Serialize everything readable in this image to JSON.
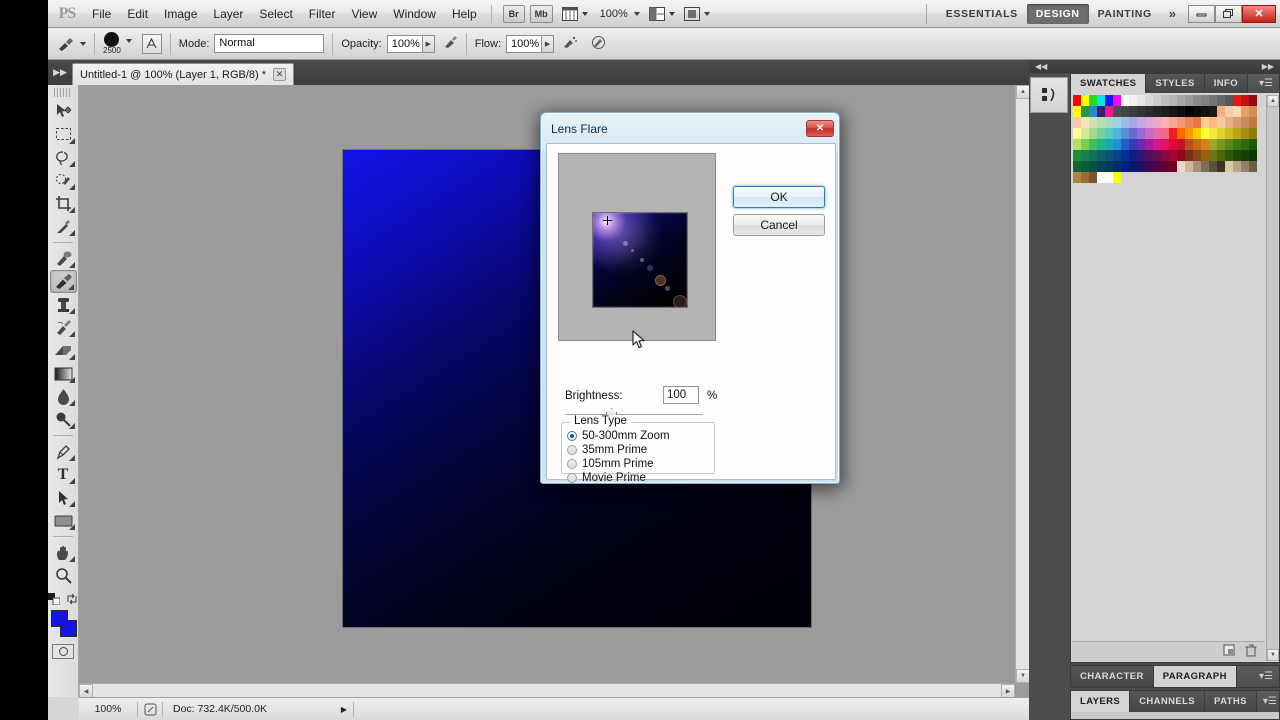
{
  "app": {
    "name": "Adobe Photoshop",
    "logo_text": "PS"
  },
  "menubar": {
    "items": [
      "File",
      "Edit",
      "Image",
      "Layer",
      "Select",
      "Filter",
      "View",
      "Window",
      "Help"
    ],
    "bridge_button": "Br",
    "minibridge_button": "Mb",
    "zoom_level": "100%",
    "workspaces": [
      "ESSENTIALS",
      "DESIGN",
      "PAINTING"
    ],
    "active_workspace": "DESIGN",
    "overflow_chevron": "»",
    "window_buttons": {
      "minimize": "━",
      "restore": "❐",
      "close": "✕"
    }
  },
  "options_bar": {
    "brush_size": "2500",
    "mode_label": "Mode:",
    "mode_value": "Normal",
    "opacity_label": "Opacity:",
    "opacity_value": "100%",
    "flow_label": "Flow:",
    "flow_value": "100%"
  },
  "document": {
    "tab_title": "Untitled-1 @ 100% (Layer 1, RGB/8) *",
    "close_glyph": "✕"
  },
  "toolbar": {
    "tools": [
      {
        "name": "move-tool",
        "glyph": "➤"
      },
      {
        "name": "rectangular-marquee-tool",
        "glyph": "⬚"
      },
      {
        "name": "lasso-tool",
        "glyph": "⬭"
      },
      {
        "name": "quick-selection-tool",
        "glyph": "✎"
      },
      {
        "name": "crop-tool",
        "glyph": "⌗"
      },
      {
        "name": "eyedropper-tool",
        "glyph": "✒"
      },
      {
        "name": "spot-healing-brush-tool",
        "glyph": "⌘"
      },
      {
        "name": "brush-tool",
        "glyph": "✏"
      },
      {
        "name": "clone-stamp-tool",
        "glyph": "⚑"
      },
      {
        "name": "history-brush-tool",
        "glyph": "✍"
      },
      {
        "name": "eraser-tool",
        "glyph": "▰"
      },
      {
        "name": "gradient-tool",
        "glyph": "■"
      },
      {
        "name": "blur-tool",
        "glyph": "●"
      },
      {
        "name": "dodge-tool",
        "glyph": "◐"
      },
      {
        "name": "pen-tool",
        "glyph": "✑"
      },
      {
        "name": "type-tool",
        "glyph": "T"
      },
      {
        "name": "path-selection-tool",
        "glyph": "➤"
      },
      {
        "name": "rectangle-tool",
        "glyph": "▭"
      },
      {
        "name": "hand-tool",
        "glyph": "✋"
      },
      {
        "name": "zoom-tool",
        "glyph": "⚲"
      }
    ],
    "selected_tool": "brush-tool",
    "foreground_color": "#1414e8",
    "background_color": "#1414e8"
  },
  "status_bar": {
    "zoom": "100%",
    "doc_info": "Doc: 732.4K/500.0K",
    "play_glyph": "▶"
  },
  "right_dock": {
    "collapse_left": "◀◀",
    "collapse_right": "▶▶",
    "top_panel": {
      "tabs": [
        "SWATCHES",
        "STYLES",
        "INFO"
      ],
      "active_tab": "SWATCHES",
      "menu_glyph": "▾☰"
    },
    "character_panel": {
      "tabs": [
        "CHARACTER",
        "PARAGRAPH"
      ],
      "active_tab": "PARAGRAPH",
      "menu_glyph": "▾☰"
    },
    "layers_panel": {
      "tabs": [
        "LAYERS",
        "CHANNELS",
        "PATHS"
      ],
      "active_tab": "LAYERS",
      "menu_glyph": "▾☰"
    },
    "swatch_colors": [
      [
        "#ff0000",
        "#ffff00",
        "#22dd22",
        "#00e5e5",
        "#1919ff",
        "#ff00ff",
        "#ffffff",
        "#f2f2f2",
        "#e6e6e6",
        "#d9d9d9",
        "#cccccc",
        "#bfbfbf",
        "#b3b3b3",
        "#a6a6a6",
        "#999999",
        "#8c8c8c",
        "#808080",
        "#737373",
        "#666666",
        "#595959",
        "#e61919",
        "#c01414",
        "#8c0f0f"
      ],
      [
        "#ffff00",
        "#1e9b44",
        "#2a86d6",
        "#3a1f7a",
        "#e81e78",
        "#4d4d4d",
        "#454545",
        "#3d3d3d",
        "#353535",
        "#2d2d2d",
        "#252525",
        "#1d1d1d",
        "#151515",
        "#0d0d0d",
        "#000000",
        "#0a0a0a",
        "#121212",
        "#1a1a1a",
        "#f4b183",
        "#f8cbad",
        "#ffd9b3",
        "#e8a06a",
        "#d98c55"
      ],
      [
        "#f6c9a0",
        "#f2e6c0",
        "#cfe0b4",
        "#b9dcb0",
        "#a9d8c8",
        "#9fd0e8",
        "#9bbce6",
        "#a8a8e0",
        "#c2a8e0",
        "#dca8dc",
        "#f0a8c8",
        "#f4b4b4",
        "#f6a890",
        "#f09878",
        "#ec8858",
        "#e87840",
        "#ffcc99",
        "#ffbb77",
        "#f6c9a0",
        "#e8b088",
        "#d99c70",
        "#cc8a5c",
        "#bf7a4a"
      ],
      [
        "#ffff99",
        "#d6e89a",
        "#9edb8c",
        "#76cf9c",
        "#5ec6c6",
        "#4fb5e0",
        "#5a8fd6",
        "#6a6ad0",
        "#9a6ad0",
        "#c86ac8",
        "#e86aa8",
        "#f06a80",
        "#f02020",
        "#ff6600",
        "#ff9900",
        "#ffcc00",
        "#ffff33",
        "#f5e642",
        "#e0d030",
        "#ccbb22",
        "#b8a618",
        "#a39010",
        "#8f7c0a"
      ],
      [
        "#b6e060",
        "#78d050",
        "#3cc060",
        "#20b888",
        "#18a8b8",
        "#2090d8",
        "#2060c8",
        "#3838b8",
        "#7028b0",
        "#a818a0",
        "#d81888",
        "#e81060",
        "#e00c38",
        "#c81028",
        "#b85018",
        "#c86818",
        "#d88018",
        "#9aa82a",
        "#7a9820",
        "#5a8818",
        "#3e7810",
        "#2e6810",
        "#1e5808"
      ],
      [
        "#1e8c3c",
        "#1a8050",
        "#167058",
        "#126068",
        "#0e5078",
        "#0a4088",
        "#063098",
        "#102080",
        "#301870",
        "#501060",
        "#700850",
        "#880840",
        "#a00830",
        "#900620",
        "#7a3010",
        "#8a4810",
        "#9a6010",
        "#6a7818",
        "#4a6810",
        "#2e5808",
        "#1e4806",
        "#164004",
        "#0e3802"
      ],
      [
        "#0e6830",
        "#0c5c3c",
        "#0a5044",
        "#084450",
        "#063860",
        "#042c70",
        "#022080",
        "#081870",
        "#201060",
        "#380850",
        "#500440",
        "#600430",
        "#700420",
        "#e8dcc4",
        "#ccb89c",
        "#a89078",
        "#807058",
        "#5c5040",
        "#3c3428",
        "#d8c8a8",
        "#b8a488",
        "#948068",
        "#6e5e48"
      ],
      [
        "#b08040",
        "#9a6c34",
        "#7e5428",
        "#ffffff",
        "#ffffff",
        "#ffff00"
      ]
    ]
  },
  "dialog": {
    "title": "Lens Flare",
    "close_glyph": "✕",
    "ok_label": "OK",
    "cancel_label": "Cancel",
    "brightness_label": "Brightness:",
    "brightness_value": "100",
    "percent_symbol": "%",
    "lens_type_legend": "Lens Type",
    "lens_types": [
      {
        "label": "50-300mm Zoom",
        "selected": true
      },
      {
        "label": "35mm Prime",
        "selected": false
      },
      {
        "label": "105mm Prime",
        "selected": false
      },
      {
        "label": "Movie Prime",
        "selected": false
      }
    ]
  }
}
